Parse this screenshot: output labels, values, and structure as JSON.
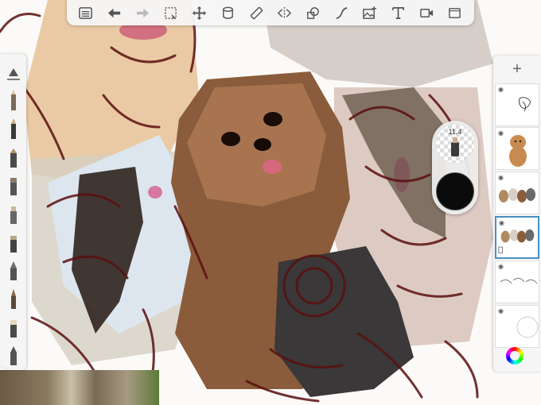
{
  "toolbar": {
    "items": [
      {
        "name": "gallery-icon"
      },
      {
        "name": "undo-icon"
      },
      {
        "name": "redo-icon"
      },
      {
        "name": "selection-icon"
      },
      {
        "name": "transform-icon"
      },
      {
        "name": "fill-icon"
      },
      {
        "name": "ruler-icon"
      },
      {
        "name": "symmetry-icon"
      },
      {
        "name": "shapes-icon"
      },
      {
        "name": "stroke-icon"
      },
      {
        "name": "image-icon"
      },
      {
        "name": "text-icon"
      },
      {
        "name": "video-icon"
      },
      {
        "name": "fullscreen-icon"
      }
    ]
  },
  "brushes": {
    "items": [
      {
        "name": "guide-icon"
      },
      {
        "name": "pencil-brush-icon"
      },
      {
        "name": "pen-brush-icon"
      },
      {
        "name": "marker-brush-icon"
      },
      {
        "name": "paint-brush-icon"
      },
      {
        "name": "airbrush-icon"
      },
      {
        "name": "chalk-brush-icon"
      },
      {
        "name": "blender-brush-icon"
      },
      {
        "name": "smudge-brush-icon"
      },
      {
        "name": "eraser-brush-icon"
      },
      {
        "name": "flat-brush-icon"
      }
    ]
  },
  "puck": {
    "size_value": "11.4",
    "color": "#0b0b0b"
  },
  "layers": {
    "items": [
      {
        "name": "layer-sketch",
        "selected": false
      },
      {
        "name": "layer-poodle",
        "selected": false
      },
      {
        "name": "layer-dogs-group",
        "selected": false
      },
      {
        "name": "layer-dogs-group-2",
        "selected": true
      },
      {
        "name": "layer-dogs-sketch",
        "selected": false
      },
      {
        "name": "layer-background",
        "selected": false
      }
    ]
  },
  "colors": {
    "brush_stroke": "#5a1010",
    "accent": "#4a90c2"
  }
}
